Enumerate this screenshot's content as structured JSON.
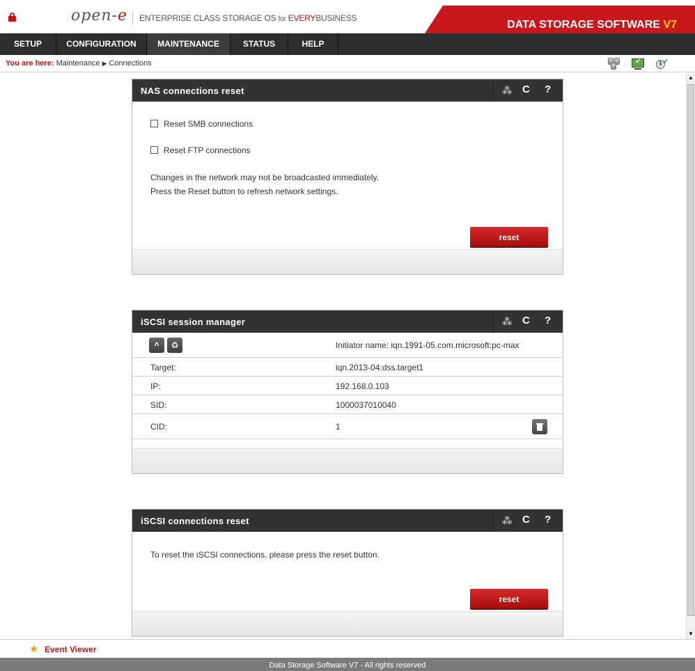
{
  "header": {
    "logo": "open-",
    "logo_accent": "e",
    "tagline_part1": "Enterprise class storage os",
    "tagline_for": "for",
    "tagline_every": "Every",
    "tagline_part2": "business",
    "brand": "DATA STORAGE SOFTWARE",
    "brand_version": "V7",
    "brand_color": "#c8181c"
  },
  "menu": [
    "SETUP",
    "CONFIGURATION",
    "MAINTENANCE",
    "STATUS",
    "HELP"
  ],
  "breadcrumb": {
    "prefix": "You are here:",
    "path1": "Maintenance",
    "path2": "Connections"
  },
  "nas_panel": {
    "title": "NAS connections reset",
    "smb_label": "Reset SMB connections",
    "smb_checked": false,
    "ftp_label": "Reset FTP connections",
    "ftp_checked": false,
    "note_line1": "Changes in the network may not be broadcasted immediately.",
    "note_line2": "Press the Reset button to refresh network settings.",
    "button": "reset"
  },
  "session_panel": {
    "title": "iSCSI session manager",
    "initiator": "Initiator name: iqn.1991-05.com.microsoft:pc-max",
    "rows": [
      {
        "key": "Target:",
        "value": "iqn.2013-04:dss.target1"
      },
      {
        "key": "IP:",
        "value": "192.168.0.103"
      },
      {
        "key": "SID:",
        "value": "1000037010040"
      },
      {
        "key": "CID:",
        "value": "1"
      }
    ]
  },
  "iscsi_reset_panel": {
    "title": "iSCSI connections reset",
    "note": "To reset the iSCSI connections, please press the reset button.",
    "button": "reset"
  },
  "event_viewer": "Event Viewer",
  "footer": "Data Storage Software V7 - All rights reserved",
  "icons": {
    "lock": "lock-icon",
    "spinner": "loading-spinner-icon",
    "refresh": "refresh-icon",
    "help": "help-icon",
    "collapse": "chevron-up-icon",
    "recycle": "recycle-icon",
    "trash": "trash-icon",
    "star": "star-icon",
    "glyph_spinner": "⁂",
    "glyph_refresh": "C",
    "glyph_help": "?",
    "glyph_chevron_up": "^",
    "glyph_recycle": "♻",
    "glyph_star": "★",
    "glyph_info": "i",
    "glyph_arrow": "▶"
  }
}
